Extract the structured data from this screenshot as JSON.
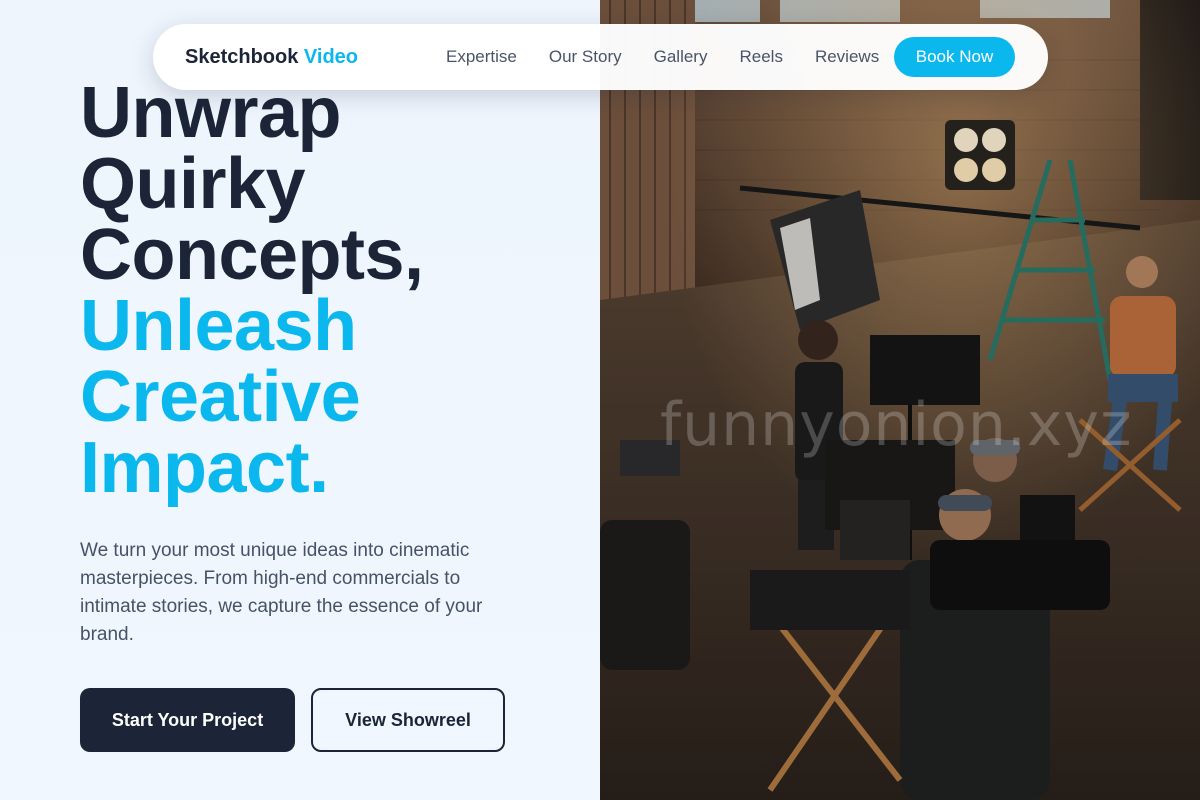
{
  "nav": {
    "brand_main": "Sketchbook",
    "brand_accent": "Video",
    "links": [
      "Expertise",
      "Our Story",
      "Gallery",
      "Reels",
      "Reviews"
    ],
    "cta": "Book Now"
  },
  "hero": {
    "title_lines_dark": [
      "Unwrap",
      "Quirky",
      "Concepts,"
    ],
    "title_lines_accent": [
      "Unleash",
      "Creative",
      "Impact."
    ],
    "description": "We turn your most unique ideas into cinematic masterpieces. From high-end commercials to intimate stories, we capture the essence of your brand.",
    "primary_button": "Start Your Project",
    "secondary_button": "View Showreel"
  },
  "image": {
    "watermark": "funnyonion.xyz"
  },
  "colors": {
    "accent": "#0bb8ee",
    "dark": "#1c2537",
    "background": "#eff6fd"
  }
}
